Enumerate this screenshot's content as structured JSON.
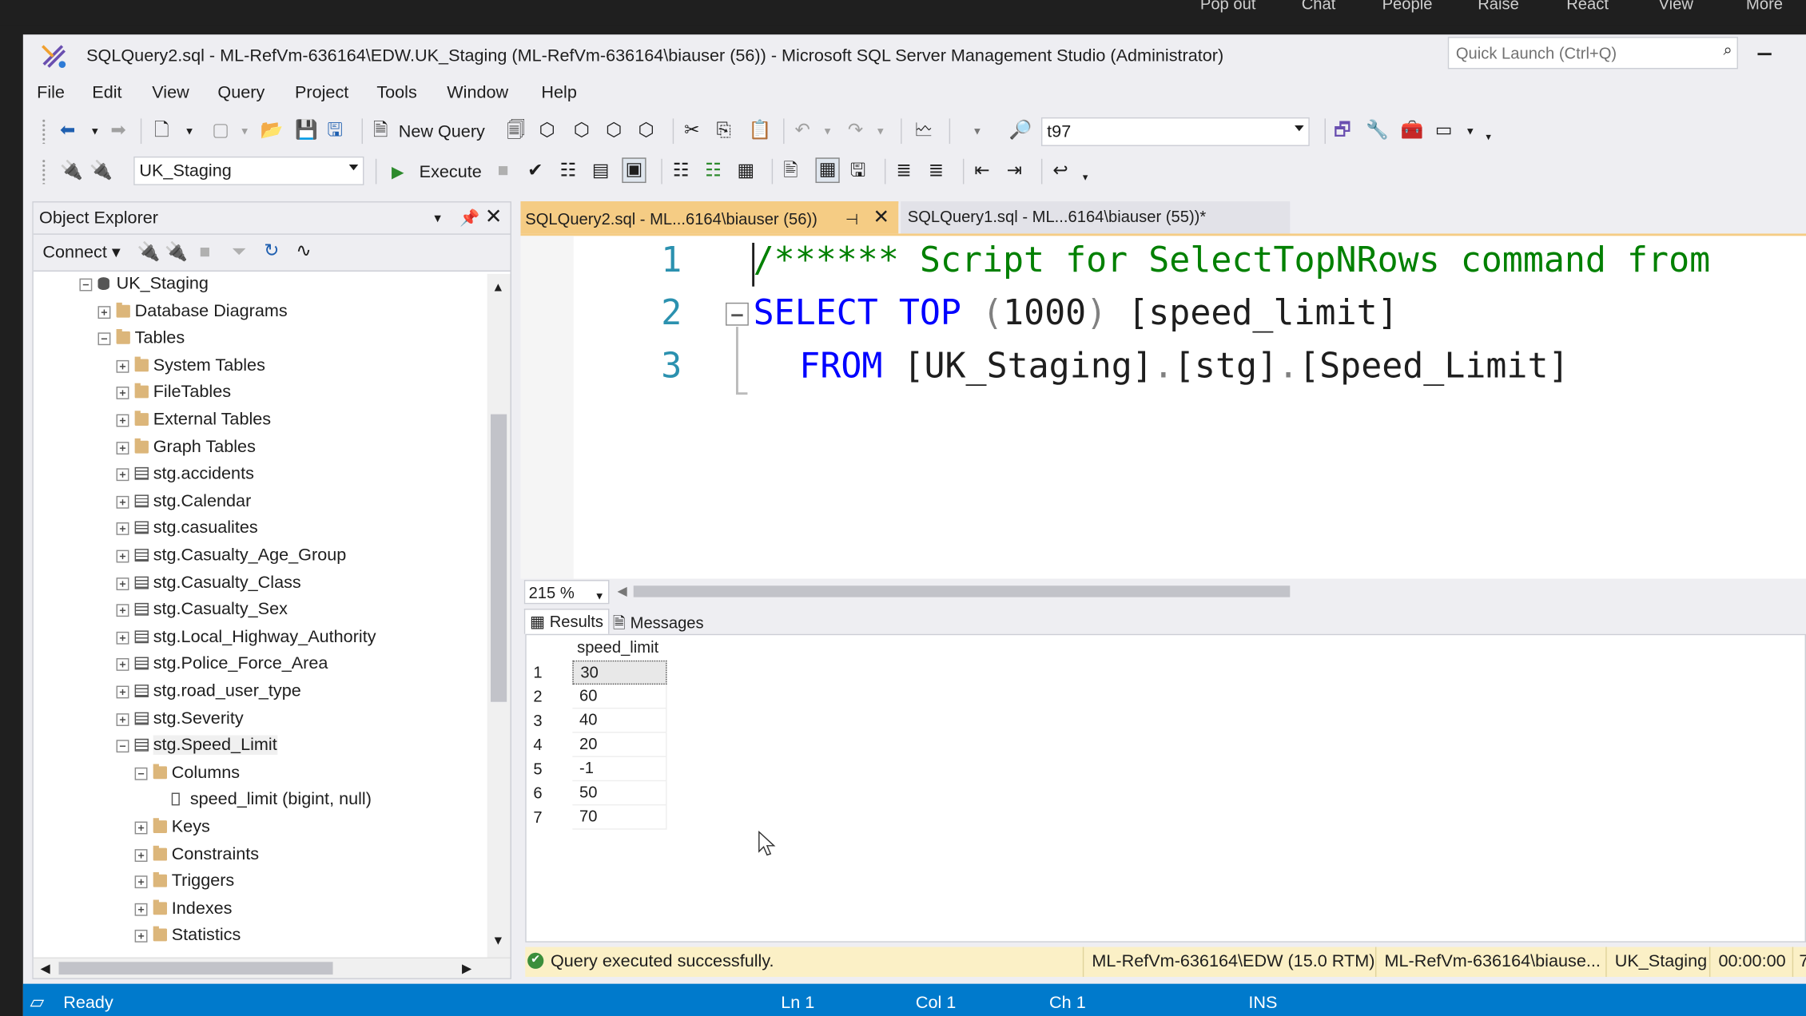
{
  "teams_bar": {
    "items": [
      "Pop out",
      "Chat",
      "People",
      "Raise",
      "React",
      "View",
      "More"
    ]
  },
  "window": {
    "title": "SQLQuery2.sql - ML-RefVm-636164\\EDW.UK_Staging (ML-RefVm-636164\\biauser (56)) - Microsoft SQL Server Management Studio (Administrator)",
    "quick_launch_placeholder": "Quick Launch (Ctrl+Q)"
  },
  "menu": [
    "File",
    "Edit",
    "View",
    "Query",
    "Project",
    "Tools",
    "Window",
    "Help"
  ],
  "toolbar1": {
    "new_query": "New Query",
    "server_combo": "t97"
  },
  "toolbar2": {
    "database_combo": "UK_Staging",
    "execute": "Execute"
  },
  "object_explorer": {
    "title": "Object Explorer",
    "connect": "Connect",
    "tree": [
      {
        "label": "UK_Staging",
        "icon": "database-icon",
        "expander": "minus",
        "level": 0
      },
      {
        "label": "Database Diagrams",
        "icon": "folder-icon",
        "expander": "plus",
        "level": 1
      },
      {
        "label": "Tables",
        "icon": "folder-icon",
        "expander": "minus",
        "level": 1
      },
      {
        "label": "System Tables",
        "icon": "folder-icon",
        "expander": "plus",
        "level": 2
      },
      {
        "label": "FileTables",
        "icon": "folder-icon",
        "expander": "plus",
        "level": 2
      },
      {
        "label": "External Tables",
        "icon": "folder-icon",
        "expander": "plus",
        "level": 2
      },
      {
        "label": "Graph Tables",
        "icon": "folder-icon",
        "expander": "plus",
        "level": 2
      },
      {
        "label": "stg.accidents",
        "icon": "table-icon",
        "expander": "plus",
        "level": 2
      },
      {
        "label": "stg.Calendar",
        "icon": "table-icon",
        "expander": "plus",
        "level": 2
      },
      {
        "label": "stg.casualites",
        "icon": "table-icon",
        "expander": "plus",
        "level": 2
      },
      {
        "label": "stg.Casualty_Age_Group",
        "icon": "table-icon",
        "expander": "plus",
        "level": 2
      },
      {
        "label": "stg.Casualty_Class",
        "icon": "table-icon",
        "expander": "plus",
        "level": 2
      },
      {
        "label": "stg.Casualty_Sex",
        "icon": "table-icon",
        "expander": "plus",
        "level": 2
      },
      {
        "label": "stg.Local_Highway_Authority",
        "icon": "table-icon",
        "expander": "plus",
        "level": 2
      },
      {
        "label": "stg.Police_Force_Area",
        "icon": "table-icon",
        "expander": "plus",
        "level": 2
      },
      {
        "label": "stg.road_user_type",
        "icon": "table-icon",
        "expander": "plus",
        "level": 2
      },
      {
        "label": "stg.Severity",
        "icon": "table-icon",
        "expander": "plus",
        "level": 2
      },
      {
        "label": "stg.Speed_Limit",
        "icon": "table-icon",
        "expander": "minus",
        "level": 2,
        "selected": true
      },
      {
        "label": "Columns",
        "icon": "folder-icon",
        "expander": "minus",
        "level": 3
      },
      {
        "label": "speed_limit (bigint, null)",
        "icon": "column-icon",
        "expander": "none",
        "level": 4
      },
      {
        "label": "Keys",
        "icon": "folder-icon",
        "expander": "plus",
        "level": 3
      },
      {
        "label": "Constraints",
        "icon": "folder-icon",
        "expander": "plus",
        "level": 3
      },
      {
        "label": "Triggers",
        "icon": "folder-icon",
        "expander": "plus",
        "level": 3
      },
      {
        "label": "Indexes",
        "icon": "folder-icon",
        "expander": "plus",
        "level": 3
      },
      {
        "label": "Statistics",
        "icon": "folder-icon",
        "expander": "plus",
        "level": 3
      }
    ]
  },
  "tabs": {
    "active": "SQLQuery2.sql - ML...6164\\biauser (56))",
    "inactive": "SQLQuery1.sql - ML...6164\\biauser (55))*"
  },
  "editor": {
    "line_numbers": [
      "1",
      "2",
      "3"
    ],
    "line1_comment": "/****** Script for SelectTopNRows command from",
    "line2": {
      "kw1": "SELECT",
      "kw2": "TOP",
      "paren_open": "(",
      "num": "1000",
      "paren_close": ")",
      "col": " [speed_limit]"
    },
    "line3": {
      "kw": "FROM",
      "db": " [UK_Staging]",
      "dot1": ".",
      "schema": "[stg]",
      "dot2": ".",
      "table": "[Speed_Limit]"
    }
  },
  "zoom": "215 %",
  "results": {
    "tab_results": "Results",
    "tab_messages": "Messages",
    "column": "speed_limit",
    "rows": [
      {
        "n": "1",
        "v": "30"
      },
      {
        "n": "2",
        "v": "60"
      },
      {
        "n": "3",
        "v": "40"
      },
      {
        "n": "4",
        "v": "20"
      },
      {
        "n": "5",
        "v": "-1"
      },
      {
        "n": "6",
        "v": "50"
      },
      {
        "n": "7",
        "v": "70"
      }
    ]
  },
  "query_status": {
    "message": "Query executed successfully.",
    "server": "ML-RefVm-636164\\EDW (15.0 RTM)",
    "user": "ML-RefVm-636164\\biause...",
    "database": "UK_Staging",
    "elapsed": "00:00:00",
    "rows_partial": "7"
  },
  "statusbar": {
    "ready": "Ready",
    "ln": "Ln 1",
    "col": "Col 1",
    "ch": "Ch 1",
    "mode": "INS"
  },
  "colors": {
    "accent_tab": "#f5cc84",
    "statusbar": "#007acc",
    "query_status_bg": "#fbf0c6",
    "keyword": "#0000ff",
    "comment": "#008000",
    "line_number": "#2b91af"
  }
}
